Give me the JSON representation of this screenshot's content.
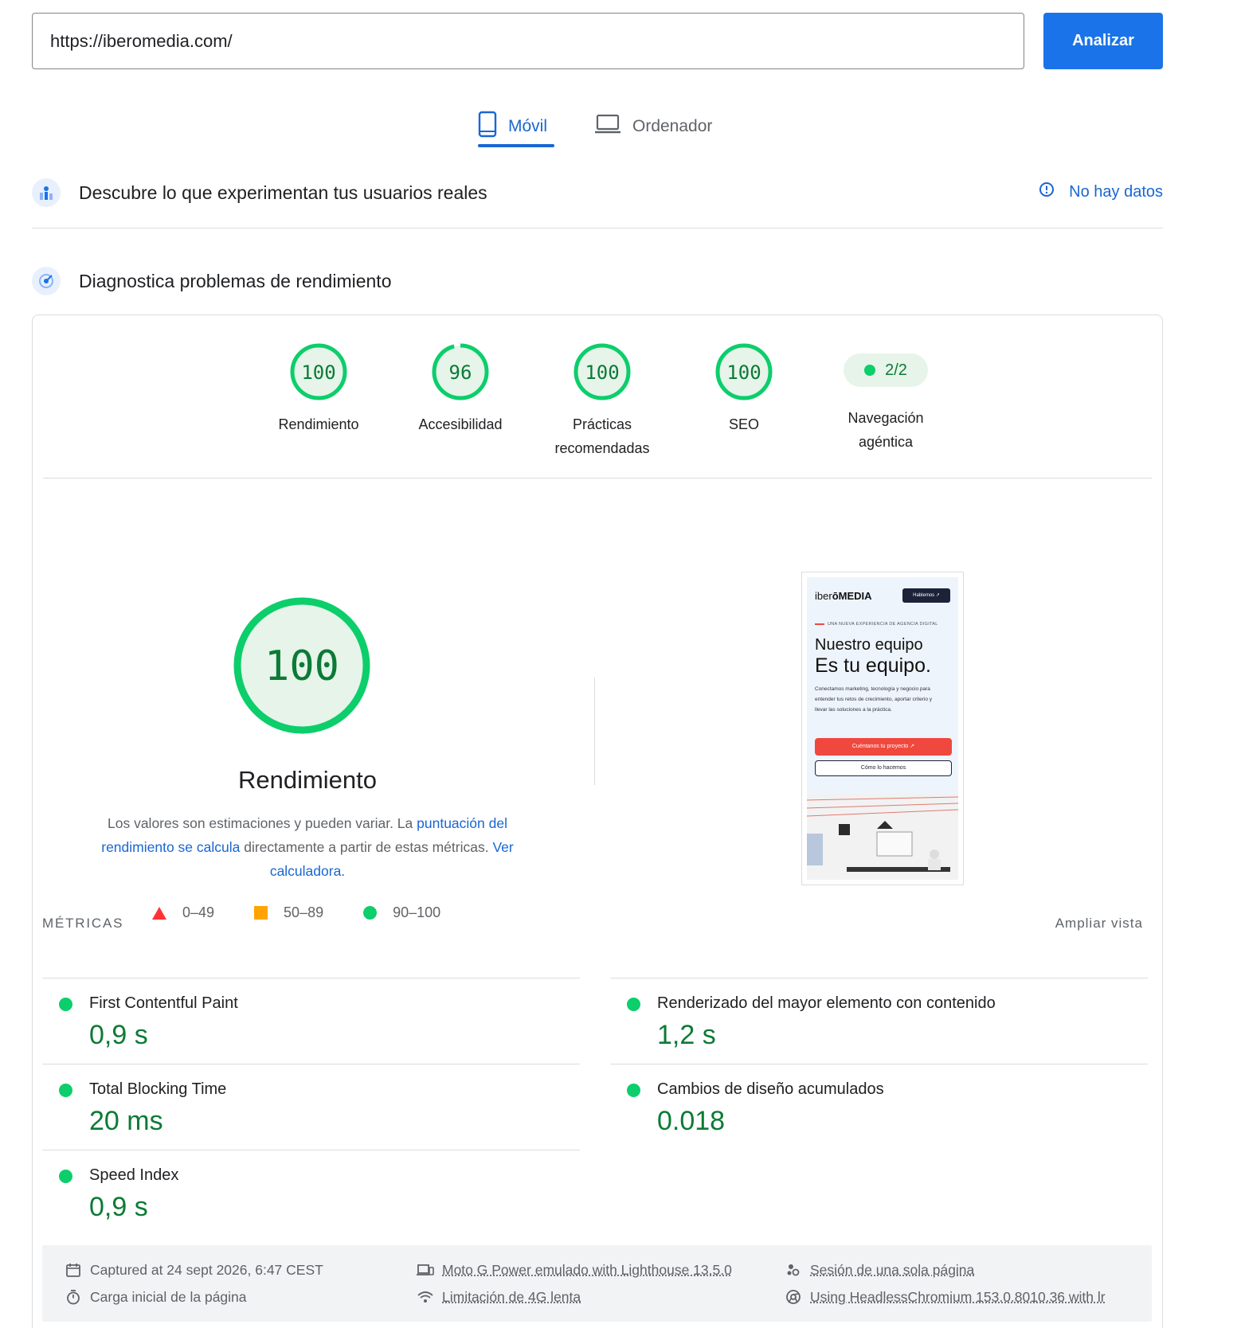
{
  "url_bar": {
    "value": "https://iberomedia.com/",
    "button_label": "Analizar"
  },
  "tabs": [
    {
      "label": "Móvil",
      "active": true,
      "icon": "smartphone-icon"
    },
    {
      "label": "Ordenador",
      "active": false,
      "icon": "laptop-icon"
    }
  ],
  "crux": {
    "title": "Descubre lo que experimentan tus usuarios reales",
    "status": "No hay datos"
  },
  "lab": {
    "title": "Diagnostica problemas de rendimiento"
  },
  "categories": [
    {
      "score": "100",
      "value": 100,
      "label": "Rendimiento"
    },
    {
      "score": "96",
      "value": 96,
      "label": "Accesibilidad"
    },
    {
      "score": "100",
      "value": 100,
      "label": "Prácticas recomendadas"
    },
    {
      "score": "100",
      "value": 100,
      "label": "SEO"
    }
  ],
  "agentic": {
    "score": "2/2",
    "label": "Navegación agéntica"
  },
  "performance": {
    "score": "100",
    "value": 100,
    "title": "Rendimiento",
    "desc_1": "Los valores son estimaciones y pueden variar. La ",
    "desc_link_1": "puntuación del rendimiento se calcula",
    "desc_2": " directamente a partir de estas métricas. ",
    "desc_link_2": "Ver calculadora."
  },
  "legend": {
    "fail": "0–49",
    "average": "50–89",
    "pass": "90–100"
  },
  "screenshot": {
    "logo_light": "iber",
    "logo_bold": "ōMEDIA",
    "top_cta": "Hablemos ↗",
    "kicker": "UNA NUEVA EXPERIENCIA DE AGENCIA DIGITAL",
    "headline_1": "Nuestro equipo",
    "headline_2": "Es tu equipo.",
    "paragraph": "Conectamos marketing, tecnología y negocio para entender tus retos de crecimiento, aportar criterio y llevar las soluciones a la práctica.",
    "cta_primary": "Cuéntanos tu proyecto ↗",
    "cta_secondary": "Cómo lo hacemos"
  },
  "metrics": {
    "section_label": "MÉTRICAS",
    "expand_label": "Ampliar vista",
    "items": [
      {
        "name": "First Contentful Paint",
        "value": "0,9 s"
      },
      {
        "name": "Renderizado del mayor elemento con contenido",
        "value": "1,2 s"
      },
      {
        "name": "Total Blocking Time",
        "value": "20 ms"
      },
      {
        "name": "Cambios de diseño acumulados",
        "value": "0.018"
      },
      {
        "name": "Speed Index",
        "value": "0,9 s"
      }
    ]
  },
  "runtime": {
    "captured": "Captured at 24 sept 2026, 6:47 CEST",
    "load_type": "Carga inicial de la página",
    "device": "Moto G Power emulado with Lighthouse 13.5.0",
    "throttling": "Limitación de 4G lenta",
    "session": "Sesión de una sola página",
    "browser": "Using HeadlessChromium 153.0.8010.36 with lr"
  },
  "colors": {
    "pass": "#0cce6b",
    "pass_text": "#0c7a35",
    "average": "#ffa400",
    "fail": "#ff3333",
    "accent": "#1a73e8"
  }
}
